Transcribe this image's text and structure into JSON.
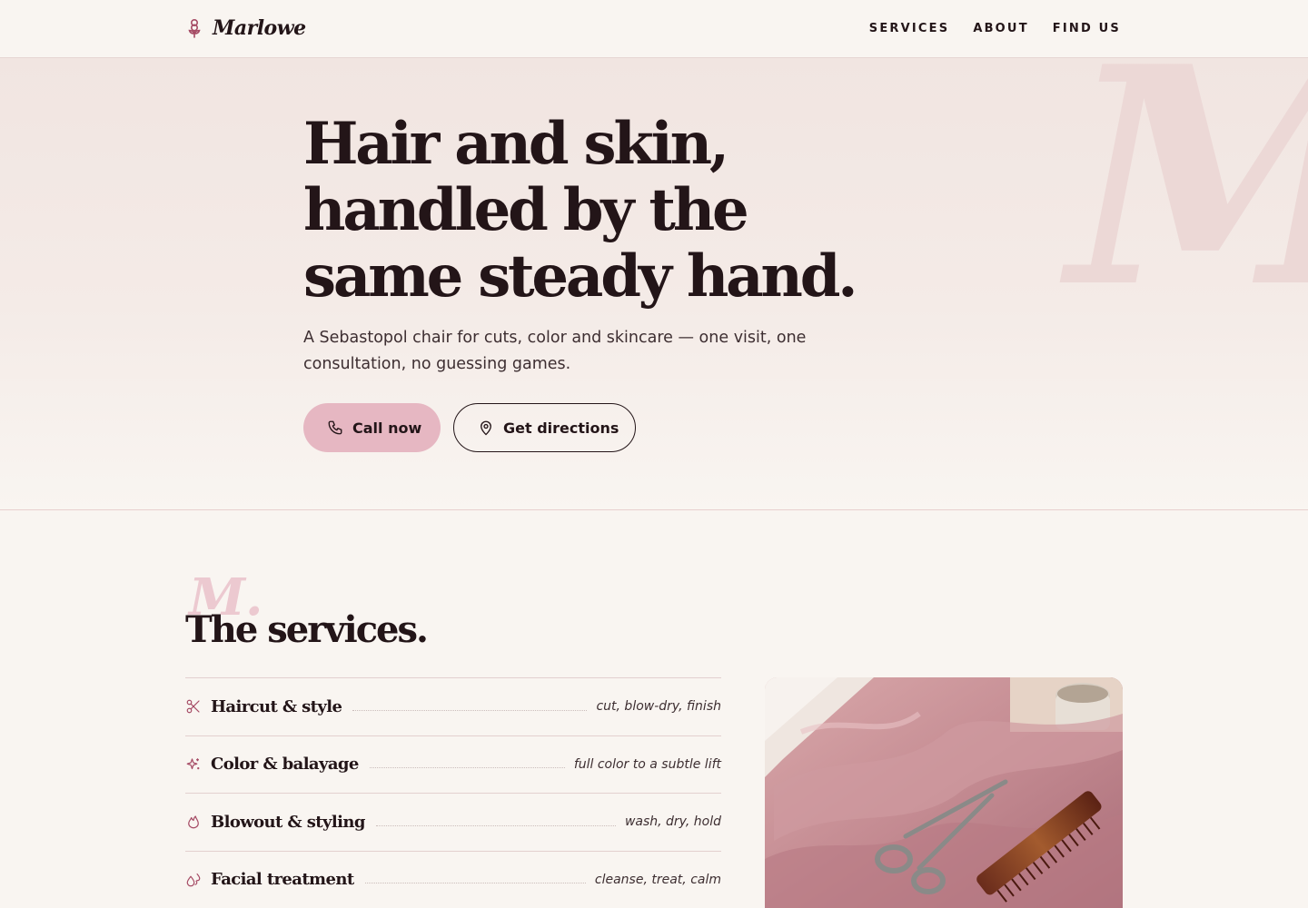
{
  "header": {
    "brand": "Marlowe",
    "nav": [
      {
        "label": "SERVICES"
      },
      {
        "label": "ABOUT"
      },
      {
        "label": "FIND US"
      }
    ]
  },
  "hero": {
    "watermark": "M",
    "title_lines": [
      "Hair and skin,",
      "handled by the",
      "same steady hand."
    ],
    "subtitle": "A Sebastopol chair for cuts, color and skincare — one visit, one consultation, no guessing games.",
    "call_label": "Call now",
    "directions_label": "Get directions"
  },
  "services": {
    "watermark": "M.",
    "title": "The services.",
    "items": [
      {
        "name": "Haircut & style",
        "desc": "cut, blow-dry, finish",
        "icon": "scissors-icon"
      },
      {
        "name": "Color & balayage",
        "desc": "full color to a subtle lift",
        "icon": "sparkle-icon"
      },
      {
        "name": "Blowout & styling",
        "desc": "wash, dry, hold",
        "icon": "flame-icon"
      },
      {
        "name": "Facial treatment",
        "desc": "cleanse, treat, calm",
        "icon": "droplets-icon"
      }
    ]
  },
  "colors": {
    "accent": "#e6b7c2",
    "ink": "#231518",
    "background": "#f9f5f1",
    "icon": "#a54a64"
  }
}
